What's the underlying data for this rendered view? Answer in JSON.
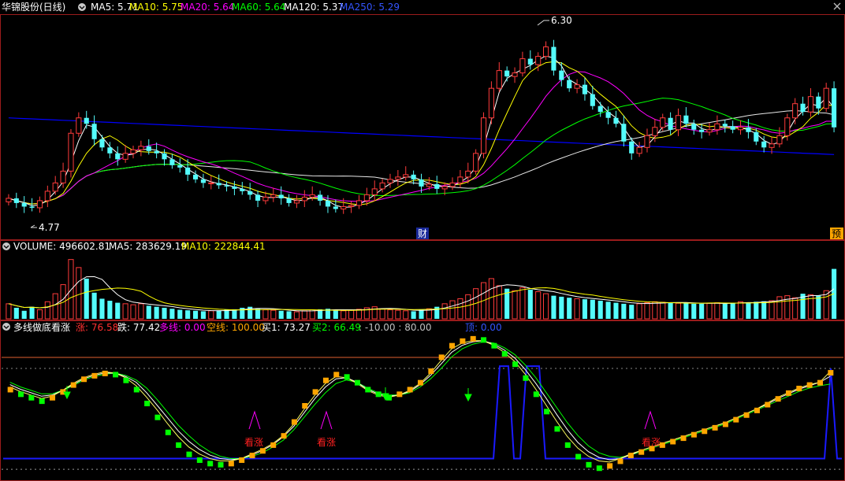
{
  "colors": {
    "bg": "#000000",
    "border": "#9b1c1c",
    "up": "#ff3b3b",
    "down": "#54fcfc",
    "ma5": "#ffffff",
    "ma10": "#ffff00",
    "ma20": "#ff00ff",
    "ma60": "#00ff00",
    "ma120": "#ffffff",
    "ma250": "#0000ff",
    "orange": "#ffa500",
    "green": "#00ff00",
    "blue": "#1a1aff",
    "magenta": "#ff00ff",
    "red": "#ff2020",
    "gray": "#c0c0c0"
  },
  "price_panel": {
    "stock_name": "华锦股份(日线)",
    "ma5": "MA5: 5.71",
    "ma10": "MA10: 5.75",
    "ma20": "MA20: 5.64",
    "ma60": "MA60: 5.64",
    "ma120": "MA120: 5.37",
    "ma250": "MA250: 5.29",
    "high_label": "6.30",
    "low_label": "4.77",
    "cai_badge": "财",
    "yu_badge": "预"
  },
  "volume_panel": {
    "label": "VOLUME: 496602.81",
    "ma5": "MA5: 283629.19",
    "ma10": "MA10: 222844.41"
  },
  "indicator_panel": {
    "name": "多线做底看涨",
    "zhang": "涨: 76.58",
    "die": "跌: 77.42",
    "duoxian": "多线: 0.00",
    "kongxian": "空线: 100.00",
    "mai1": "买1: 73.27",
    "mai2": "买2: 66.49",
    "ref_lines": ": -10.00 : 80.00",
    "ding": "顶: 0.00",
    "signal_text": "看涨"
  },
  "chart_data": [
    {
      "type": "candlestick",
      "title": "华锦股份(日线)",
      "ylim": [
        4.6,
        6.45
      ],
      "annotations": [
        {
          "label": "6.30",
          "value": 6.3
        },
        {
          "label": "4.77",
          "value": 4.77
        }
      ],
      "ma_legend": {
        "MA5": 5.71,
        "MA10": 5.75,
        "MA20": 5.64,
        "MA60": 5.64,
        "MA120": 5.37,
        "MA250": 5.29
      },
      "close": [
        4.92,
        4.88,
        4.85,
        4.84,
        4.9,
        4.98,
        5.05,
        5.15,
        5.47,
        5.6,
        5.55,
        5.42,
        5.35,
        5.3,
        5.25,
        5.3,
        5.33,
        5.36,
        5.32,
        5.3,
        5.25,
        5.2,
        5.18,
        5.12,
        5.08,
        5.05,
        5.05,
        5.03,
        5.02,
        5.0,
        4.98,
        4.95,
        4.9,
        4.93,
        4.95,
        4.92,
        4.88,
        4.9,
        4.93,
        4.95,
        4.9,
        4.85,
        4.83,
        4.85,
        4.86,
        4.9,
        4.95,
        5.0,
        5.05,
        5.08,
        5.1,
        5.12,
        5.08,
        5.02,
        5.04,
        5.0,
        5.02,
        5.05,
        5.1,
        5.15,
        5.3,
        5.6,
        5.85,
        6.0,
        5.95,
        5.98,
        6.1,
        6.05,
        6.12,
        6.2,
        6.0,
        5.92,
        5.85,
        5.88,
        5.8,
        5.7,
        5.65,
        5.6,
        5.55,
        5.4,
        5.3,
        5.35,
        5.45,
        5.52,
        5.6,
        5.5,
        5.62,
        5.55,
        5.5,
        5.48,
        5.5,
        5.55,
        5.53,
        5.5,
        5.52,
        5.48,
        5.4,
        5.35,
        5.38,
        5.45,
        5.6,
        5.72,
        5.65,
        5.78,
        5.68,
        5.85,
        5.52
      ]
    },
    {
      "type": "bar",
      "title": "VOLUME",
      "ylim": [
        0,
        650000
      ],
      "legend": {
        "VOLUME": 496602.81,
        "MA5": 283629.19,
        "MA10": 222844.41
      },
      "values": [
        150000,
        110000,
        80000,
        120000,
        90000,
        170000,
        250000,
        340000,
        590000,
        510000,
        400000,
        260000,
        200000,
        180000,
        160000,
        150000,
        140000,
        150000,
        130000,
        120000,
        110000,
        100000,
        90000,
        85000,
        80000,
        75000,
        80000,
        85000,
        90000,
        95000,
        110000,
        120000,
        100000,
        90000,
        85000,
        80000,
        75000,
        70000,
        80000,
        90000,
        95000,
        100000,
        90000,
        80000,
        85000,
        95000,
        110000,
        120000,
        100000,
        90000,
        85000,
        80000,
        75000,
        90000,
        100000,
        120000,
        150000,
        180000,
        200000,
        240000,
        300000,
        360000,
        400000,
        330000,
        300000,
        280000,
        310000,
        290000,
        270000,
        250000,
        230000,
        220000,
        210000,
        200000,
        195000,
        190000,
        180000,
        170000,
        160000,
        150000,
        140000,
        150000,
        160000,
        170000,
        165000,
        160000,
        155000,
        160000,
        150000,
        150000,
        155000,
        160000,
        150000,
        160000,
        170000,
        165000,
        170000,
        175000,
        180000,
        220000,
        230000,
        210000,
        250000,
        240000,
        230000,
        280000,
        496602
      ]
    },
    {
      "type": "line",
      "title": "多线做底看涨",
      "ylim": [
        -14,
        110
      ],
      "series": [
        {
          "name": "涨",
          "values": [
            62,
            58,
            55,
            52,
            55,
            60,
            66,
            71,
            74,
            76,
            75,
            70,
            62,
            50,
            38,
            25,
            14,
            6,
            1,
            -2,
            -3,
            -2,
            1,
            5,
            9,
            14,
            22,
            34,
            48,
            60,
            70,
            75,
            73,
            68,
            62,
            58,
            55,
            58,
            62,
            68,
            78,
            90,
            100,
            104,
            106,
            105,
            100,
            93,
            84,
            72,
            58,
            43,
            28,
            14,
            4,
            -3,
            -6,
            -4,
            0,
            5,
            8,
            11,
            14,
            17,
            20,
            23,
            26,
            29,
            32,
            36,
            40,
            44,
            49,
            54,
            59,
            63,
            66,
            68,
            76.58
          ]
        },
        {
          "name": "跌",
          "values": [
            64,
            60,
            57,
            54,
            56,
            61,
            67,
            72,
            75,
            77,
            76,
            72,
            65,
            55,
            44,
            32,
            21,
            12,
            6,
            2,
            0,
            0,
            2,
            6,
            10,
            15,
            22,
            32,
            45,
            57,
            67,
            73,
            72,
            67,
            61,
            57,
            55,
            57,
            61,
            67,
            76,
            87,
            97,
            102,
            104,
            104,
            100,
            94,
            86,
            75,
            62,
            48,
            34,
            21,
            11,
            4,
            0,
            -1,
            2,
            6,
            9,
            12,
            15,
            18,
            21,
            24,
            27,
            30,
            33,
            37,
            41,
            45,
            50,
            55,
            59,
            63,
            66,
            68,
            77.42
          ]
        },
        {
          "name": "买1",
          "values": [
            66,
            62,
            59,
            56,
            57,
            61,
            66,
            71,
            74,
            76,
            76,
            73,
            68,
            59,
            48,
            37,
            26,
            17,
            10,
            5,
            2,
            1,
            2,
            5,
            9,
            14,
            21,
            30,
            42,
            54,
            64,
            71,
            72,
            68,
            62,
            58,
            56,
            57,
            60,
            66,
            74,
            84,
            94,
            100,
            103,
            104,
            101,
            96,
            89,
            79,
            67,
            54,
            40,
            27,
            16,
            8,
            3,
            1,
            2,
            5,
            9,
            12,
            15,
            18,
            21,
            24,
            27,
            30,
            33,
            37,
            41,
            45,
            49,
            54,
            58,
            62,
            65,
            68,
            73.27
          ]
        },
        {
          "name": "买2",
          "values": [
            68,
            64,
            61,
            58,
            58,
            61,
            65,
            70,
            73,
            75,
            76,
            74,
            70,
            63,
            53,
            42,
            31,
            22,
            14,
            8,
            4,
            2,
            2,
            4,
            7,
            12,
            18,
            27,
            38,
            49,
            59,
            67,
            70,
            68,
            63,
            59,
            57,
            57,
            59,
            64,
            71,
            80,
            90,
            97,
            101,
            103,
            102,
            98,
            92,
            83,
            72,
            59,
            46,
            33,
            22,
            13,
            7,
            4,
            3,
            5,
            8,
            11,
            14,
            17,
            20,
            23,
            26,
            29,
            32,
            36,
            40,
            44,
            48,
            52,
            56,
            60,
            63,
            65,
            66.49
          ]
        }
      ],
      "reference_lines": [
        -10,
        80
      ],
      "signals": [
        {
          "label": "看涨",
          "count": 3
        }
      ],
      "legend": {
        "涨": 76.58,
        "跌": 77.42,
        "多线": 0.0,
        "空线": 100.0,
        "买1": 73.27,
        "买2": 66.49,
        "顶": 0.0
      }
    }
  ]
}
